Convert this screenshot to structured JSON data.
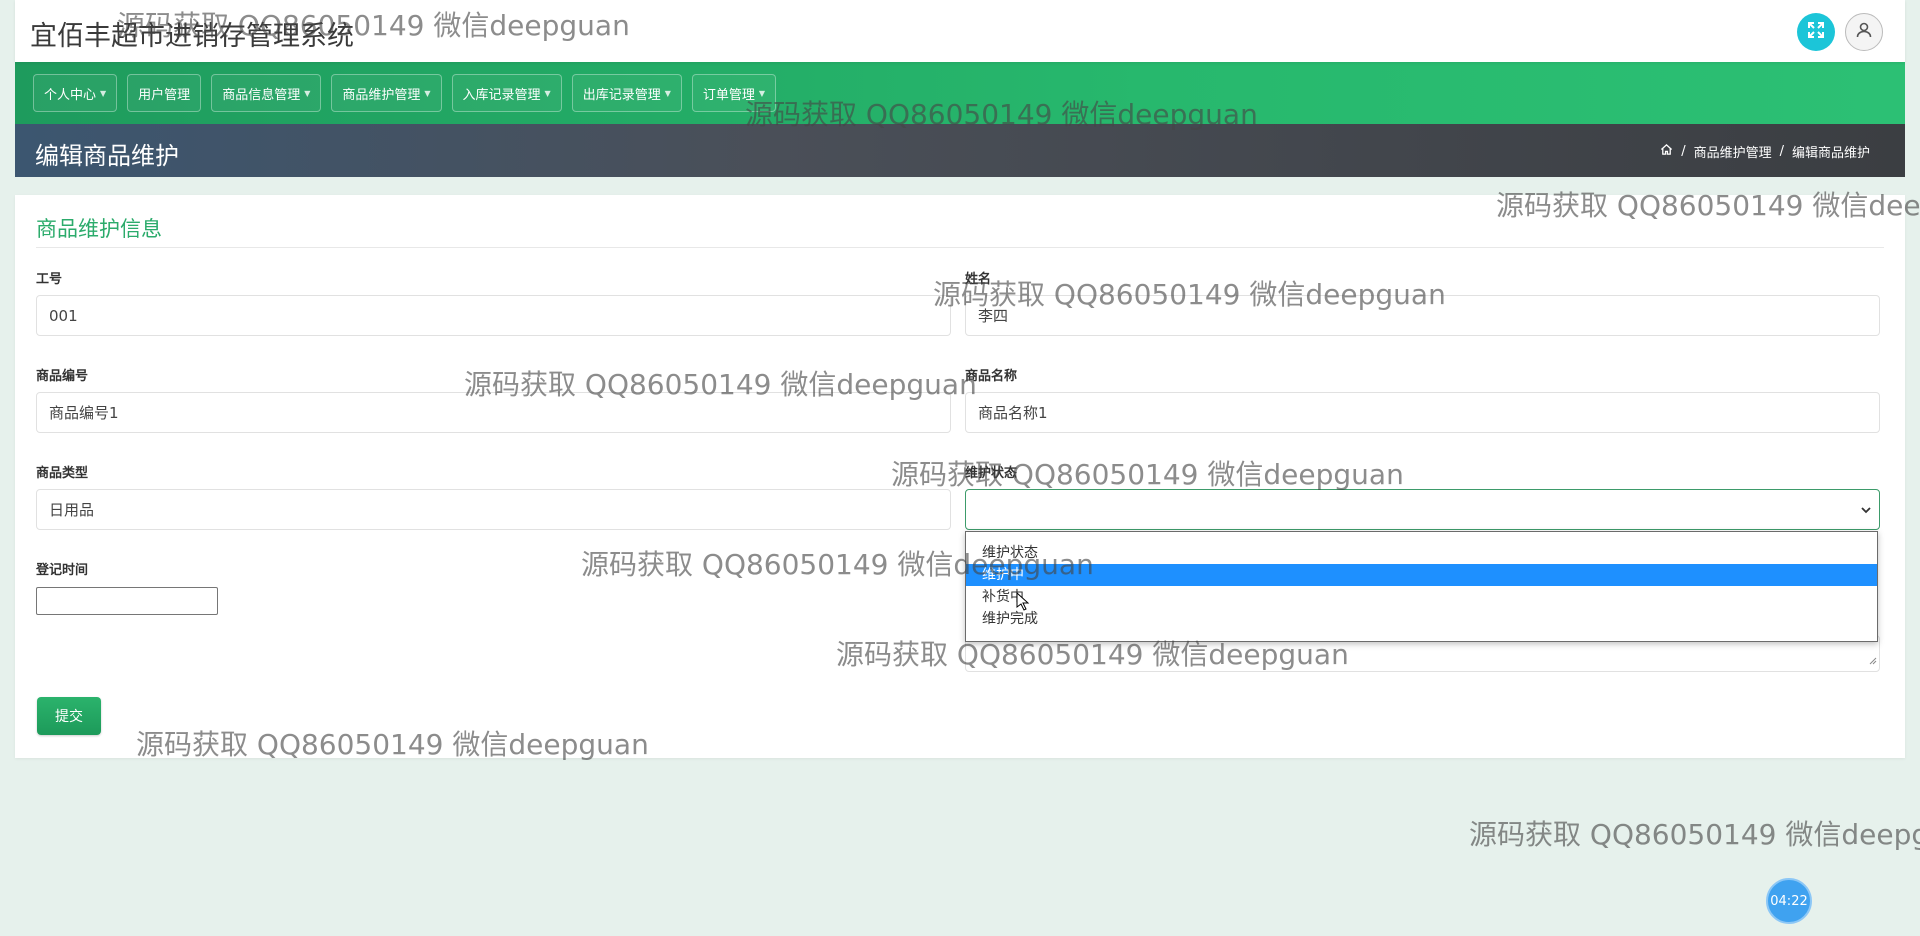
{
  "app": {
    "title": "宜佰丰超市进销存管理系统"
  },
  "nav": [
    {
      "label": "个人中心",
      "has_caret": true
    },
    {
      "label": "用户管理",
      "has_caret": false
    },
    {
      "label": "商品信息管理",
      "has_caret": true
    },
    {
      "label": "商品维护管理",
      "has_caret": true
    },
    {
      "label": "入库记录管理",
      "has_caret": true
    },
    {
      "label": "出库记录管理",
      "has_caret": true
    },
    {
      "label": "订单管理",
      "has_caret": true
    }
  ],
  "page": {
    "title": "编辑商品维护",
    "breadcrumb": [
      "商品维护管理",
      "编辑商品维护"
    ]
  },
  "form": {
    "section_title": "商品维护信息",
    "fields": {
      "gonghao": {
        "label": "工号",
        "value": "001"
      },
      "xingming": {
        "label": "姓名",
        "value": "李四"
      },
      "shangpinbianhao": {
        "label": "商品编号",
        "value": "商品编号1"
      },
      "shangpinmingcheng": {
        "label": "商品名称",
        "value": "商品名称1"
      },
      "shangpinleixing": {
        "label": "商品类型",
        "value": "日用品"
      },
      "weihuzhuangtai": {
        "label": "维护状态",
        "value": ""
      },
      "dengjishijian": {
        "label": "登记时间",
        "value": ""
      }
    },
    "status_options": [
      "维护状态",
      "维护中",
      "补货中",
      "维护完成"
    ],
    "status_highlighted": "维护中",
    "submit_label": "提交"
  },
  "timer": "04:22",
  "watermark": "源码获取 QQ86050149 微信deepguan",
  "colors": {
    "nav_green": "#27b86d",
    "title_green": "#2bab6b",
    "highlight_blue": "#1e90ff",
    "expand_cyan": "#1cc5d8"
  },
  "icons": [
    "expand-icon",
    "user-icon",
    "home-icon",
    "chevron-down-icon",
    "mouse-cursor-icon",
    "resize-grip-icon"
  ]
}
